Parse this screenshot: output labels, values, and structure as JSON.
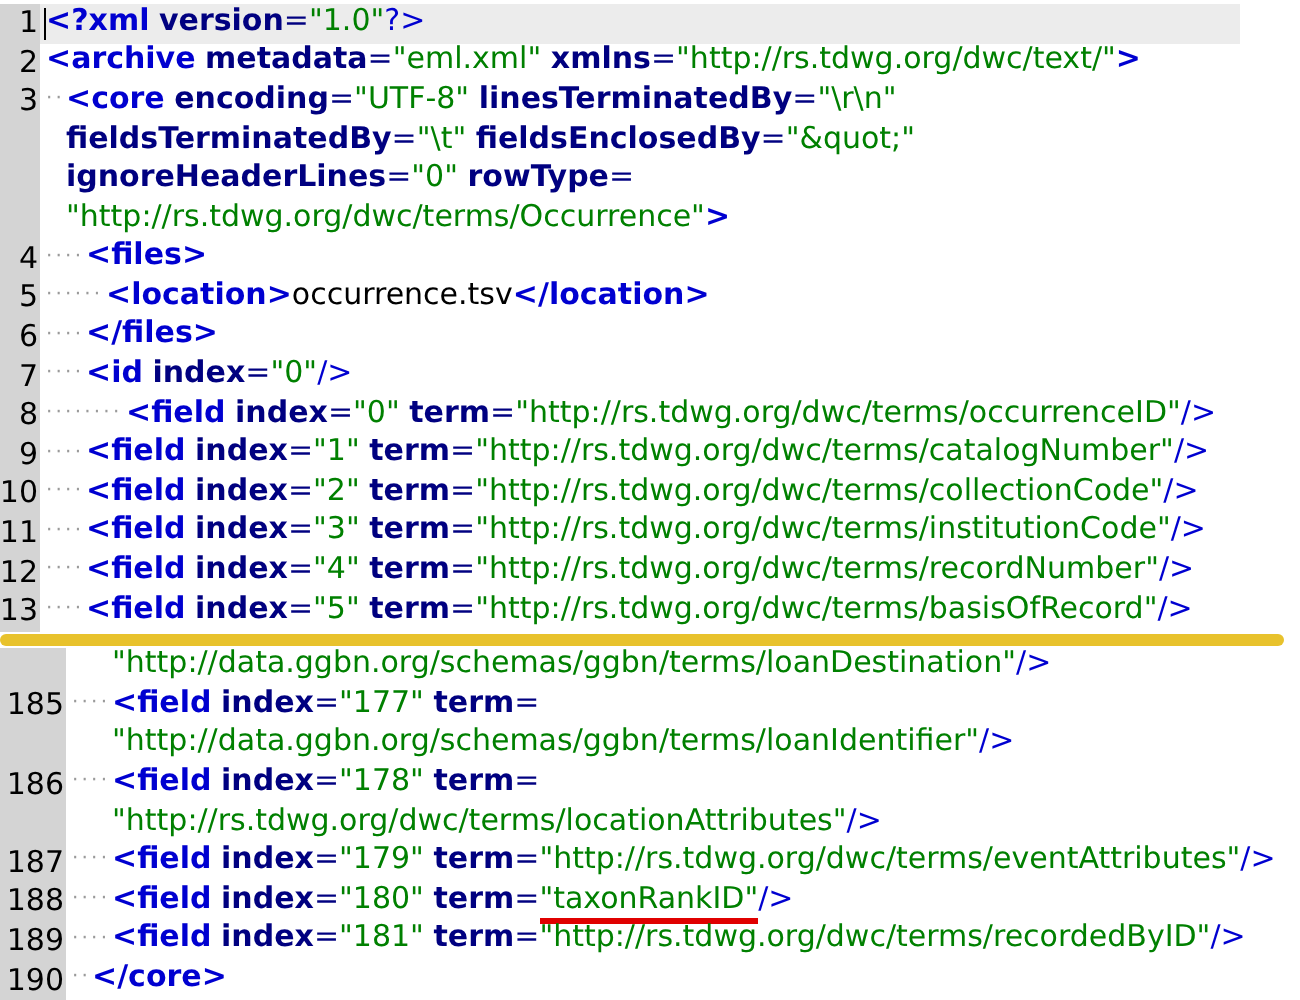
{
  "sections": [
    {
      "lines": [
        {
          "number": "1",
          "current": true,
          "rows": [
            [
              {
                "t": "<?xml version=\"1.0\"?>"
              }
            ]
          ]
        },
        {
          "number": "2",
          "current": false,
          "rows": [
            [
              {
                "t": "<archive metadata=\"eml.xml\" xmlns=\"http://rs.tdwg.org/dwc/text/\">"
              }
            ]
          ]
        },
        {
          "number": "3",
          "current": false,
          "rows": [
            [
              {
                "t": "··<core encoding=\"UTF-8\" linesTerminatedBy=\"\\r\\n\""
              }
            ],
            [
              {
                "t": "fieldsTerminatedBy=\"\\t\" fieldsEnclosedBy=\"&quot;\""
              }
            ],
            [
              {
                "t": "ignoreHeaderLines=\"0\" rowType="
              }
            ],
            [
              {
                "t": "\"http://rs.tdwg.org/dwc/terms/Occurrence\">"
              }
            ]
          ]
        },
        {
          "number": "4",
          "current": false,
          "rows": [
            [
              {
                "t": "····<files>"
              }
            ]
          ]
        },
        {
          "number": "5",
          "current": false,
          "rows": [
            [
              {
                "t": "······<location>occurrence.tsv</location>"
              }
            ]
          ]
        },
        {
          "number": "6",
          "current": false,
          "rows": [
            [
              {
                "t": "····</files>"
              }
            ]
          ]
        },
        {
          "number": "7",
          "current": false,
          "rows": [
            [
              {
                "t": "····<id index=\"0\"/>"
              }
            ]
          ]
        },
        {
          "number": "8",
          "current": false,
          "rows": [
            [
              {
                "t": "········<field index=\"0\" term=\"http://rs.tdwg.org/dwc/terms/occurrenceID\"/>"
              }
            ]
          ]
        },
        {
          "number": "9",
          "current": false,
          "rows": [
            [
              {
                "t": "····<field index=\"1\" term=\"http://rs.tdwg.org/dwc/terms/catalogNumber\"/>"
              }
            ]
          ]
        },
        {
          "number": "10",
          "current": false,
          "rows": [
            [
              {
                "t": "····<field index=\"2\" term=\"http://rs.tdwg.org/dwc/terms/collectionCode\"/>"
              }
            ]
          ]
        },
        {
          "number": "11",
          "current": false,
          "rows": [
            [
              {
                "t": "····<field index=\"3\" term=\"http://rs.tdwg.org/dwc/terms/institutionCode\"/>"
              }
            ]
          ]
        },
        {
          "number": "12",
          "current": false,
          "rows": [
            [
              {
                "t": "····<field index=\"4\" term=\"http://rs.tdwg.org/dwc/terms/recordNumber\"/>"
              }
            ]
          ]
        },
        {
          "number": "13",
          "current": false,
          "rows": [
            [
              {
                "t": "····<field index=\"5\" term=\"http://rs.tdwg.org/dwc/terms/basisOfRecord\"/>"
              }
            ]
          ]
        }
      ]
    },
    {
      "lines": [
        {
          "current": false,
          "rows": [
            [
              {
                "t": "\"http://data.ggbn.org/schemas/ggbn/terms/loanDestination\"/>"
              }
            ]
          ]
        },
        {
          "number": "185",
          "current": false,
          "rows": [
            [
              {
                "t": "····<field index=\"177\" term="
              }
            ],
            [
              {
                "t": "\"http://data.ggbn.org/schemas/ggbn/terms/loanIdentifier\"/>"
              }
            ]
          ]
        },
        {
          "number": "186",
          "current": false,
          "rows": [
            [
              {
                "t": "····<field index=\"178\" term="
              }
            ],
            [
              {
                "t": "\"http://rs.tdwg.org/dwc/terms/locationAttributes\"/>"
              }
            ]
          ]
        },
        {
          "number": "187",
          "current": false,
          "rows": [
            [
              {
                "t": "····<field index=\"179\" term=\"http://rs.tdwg.org/dwc/terms/eventAttributes\"/>"
              }
            ]
          ]
        },
        {
          "number": "188",
          "current": false,
          "rows": [
            [
              {
                "t": "····<field index=\"180\" term="
              },
              {
                "t": "\"taxonRankID\"",
                "underlined": true
              },
              {
                "t": "/>"
              }
            ]
          ]
        },
        {
          "number": "189",
          "current": false,
          "rows": [
            [
              {
                "t": "····<field index=\"181\" term=\"http://rs.tdwg.org/dwc/terms/recordedByID\"/>"
              }
            ]
          ]
        },
        {
          "number": "190",
          "current": false,
          "rows": [
            [
              {
                "t": "··</core>"
              }
            ]
          ]
        }
      ]
    }
  ]
}
